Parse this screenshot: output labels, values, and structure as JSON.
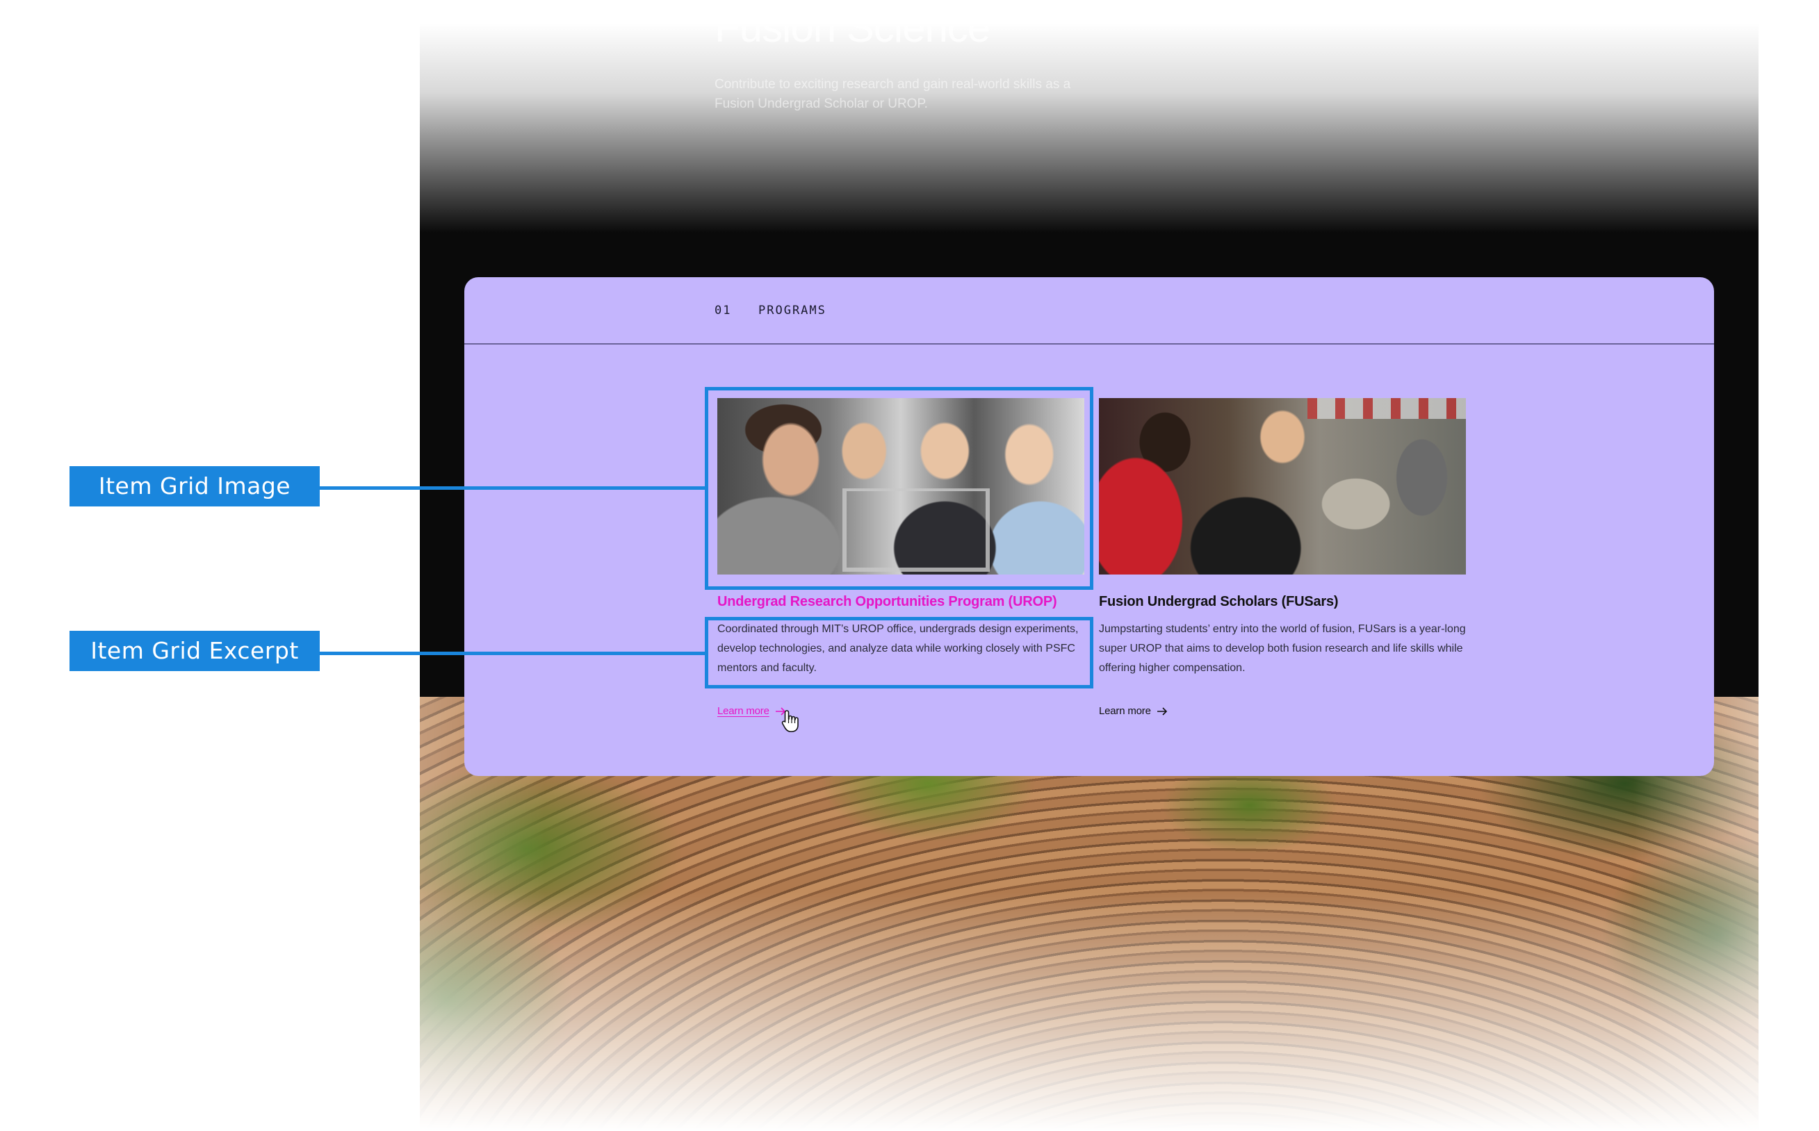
{
  "hero": {
    "title": "Fusion Science",
    "subtitle": "Contribute to exciting research and gain real-world skills as a Fusion Undergrad Scholar or UROP."
  },
  "programs_section": {
    "number": "01",
    "label": "PROGRAMS",
    "background_color": "#c4b5fd",
    "accent_color": "#e516c6",
    "cards": [
      {
        "title": "Undergrad Research Opportunities Program (UROP)",
        "excerpt": "Coordinated through MIT’s UROP office, undergrads design experiments, develop technologies, and analyze data while working closely with PSFC mentors and faculty.",
        "link_label": "Learn more",
        "link_icon": "arrow-right-icon",
        "state": "hover"
      },
      {
        "title": "Fusion Undergrad Scholars (FUSars)",
        "excerpt": "Jumpstarting students’ entry into the world of fusion, FUSars is a year-long super UROP that aims to develop both fusion research and life skills while offering higher compensation.",
        "link_label": "Learn more",
        "link_icon": "arrow-right-icon",
        "state": "default"
      }
    ]
  },
  "annotations": {
    "color": "#1a86dd",
    "image_label": "Item Grid Image",
    "excerpt_label": "Item Grid Excerpt"
  },
  "cursor": {
    "icon": "hand-pointer-icon"
  }
}
